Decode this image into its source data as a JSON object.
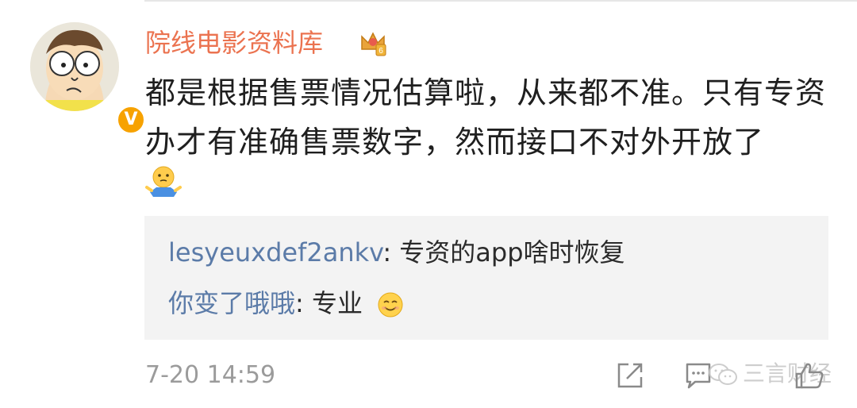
{
  "user": {
    "name": "院线电影资料库",
    "verified_mark": "V"
  },
  "comment": {
    "text": "都是根据售票情况估算啦，从来都不准。只有专资办才有准确售票数字，然而接口不对外开放了"
  },
  "replies": [
    {
      "author": "lesyeuxdef2ankv",
      "separator": ": ",
      "text": "专资的app啥时恢复"
    },
    {
      "author": "你变了哦哦",
      "separator": ": ",
      "text": "专业"
    }
  ],
  "footer": {
    "timestamp": "7-20 14:59",
    "watermark": "三言财经"
  },
  "colors": {
    "username": "#eb7350",
    "reply_author": "#5b7ba8",
    "reply_bg": "#f3f3f3",
    "verified_badge": "#f7a200"
  },
  "icons": {
    "vip": "crown-level-badge-icon",
    "shrug": "shrug-emoji-icon",
    "smile": "smile-emoji-icon",
    "share": "share-icon",
    "comment": "comment-icon",
    "like": "thumbs-up-icon"
  }
}
